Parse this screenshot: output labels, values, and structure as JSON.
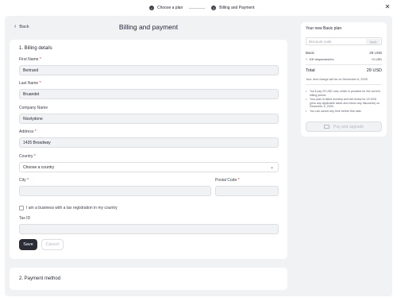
{
  "stepper": {
    "step1": {
      "label": "Choose a plan",
      "marker": "✓"
    },
    "step2": {
      "label": "Billing and Payment",
      "marker": "2"
    }
  },
  "header": {
    "back_label": "Back",
    "title": "Billing and payment"
  },
  "billing": {
    "section_title": "1. Billing details",
    "first_name": {
      "label": "First Name",
      "value": "Bertrand"
    },
    "last_name": {
      "label": "Last Name",
      "value": "Bruandet"
    },
    "company": {
      "label": "Company Name",
      "value": "Nicelydone"
    },
    "address": {
      "label": "Address",
      "value": "1435 Broadway"
    },
    "country": {
      "label": "Country",
      "value": "Choose a country"
    },
    "city": {
      "label": "City",
      "value": ""
    },
    "postal": {
      "label": "Postal Code",
      "value": ""
    },
    "business_checkbox_label": "I am a business with a tax registration in my country",
    "tax_id": {
      "label": "Tax ID",
      "value": ""
    },
    "save_label": "Save",
    "cancel_label": "Cancel"
  },
  "payment": {
    "section_title": "2. Payment method"
  },
  "summary": {
    "title": "Your new Basic plan",
    "discount_placeholder": "Discount code",
    "apply_label": "Apply",
    "basic_label": "Basic",
    "basic_price": "29 USD",
    "responses_label": "100 responses/mo",
    "responses_price": "+0 USD",
    "total_label": "Total",
    "total_price": "29 USD",
    "next_charge": "Your next charge will be on December 6, 2025",
    "bullets": [
      "You'll pay 29 USD now, which is prorated for the current billing period.",
      "Your plan is billed monthly and will renew for 29 USD (plus any applicable taxes and minus any discounts) on December 6, 2025.",
      "You can cancel any time before this date."
    ],
    "pay_label": "Pay and upgrade"
  }
}
